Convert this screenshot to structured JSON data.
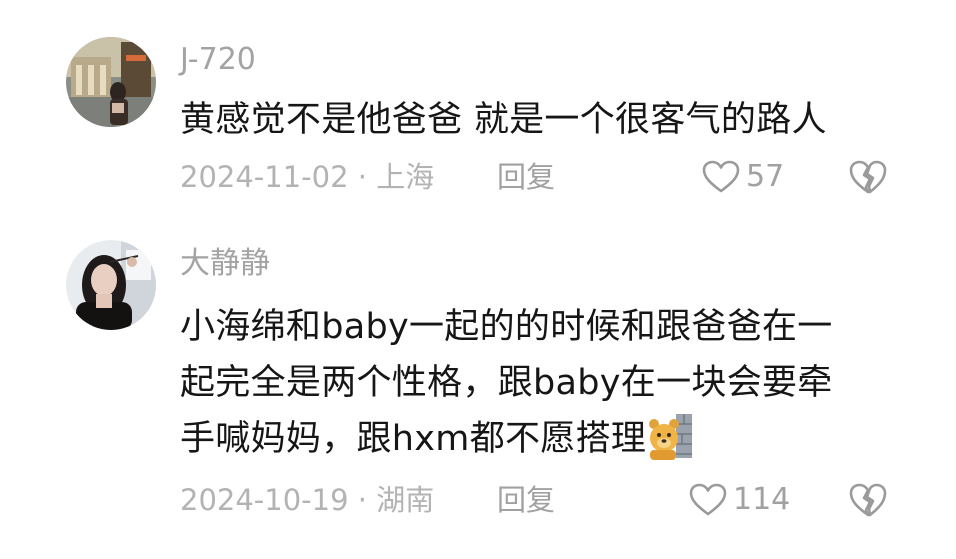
{
  "comments": [
    {
      "username": "J-720",
      "content_lines": [
        "黄感觉不是他爸爸 就是一个很客气的路人"
      ],
      "date_location": "2024-11-02 · 上海",
      "reply_label": "回复",
      "likes": "57",
      "avatar_icon": "user-photo-avatar"
    },
    {
      "username": "大静静",
      "content_lines": [
        "小海绵和baby一起的的时候和跟爸爸在一",
        "起完全是两个性格，跟baby在一块会要牵",
        "手喊妈妈，跟hxm都不愿搭理"
      ],
      "emoji": "bear-peeking-emoji",
      "date_location": "2024-10-19 · 湖南",
      "reply_label": "回复",
      "likes": "114",
      "avatar_icon": "user-photo-avatar"
    }
  ],
  "colors": {
    "username": "#a3a3a3",
    "content": "#161616",
    "meta": "#b3b3b3",
    "icon": "#9a9a9a"
  }
}
